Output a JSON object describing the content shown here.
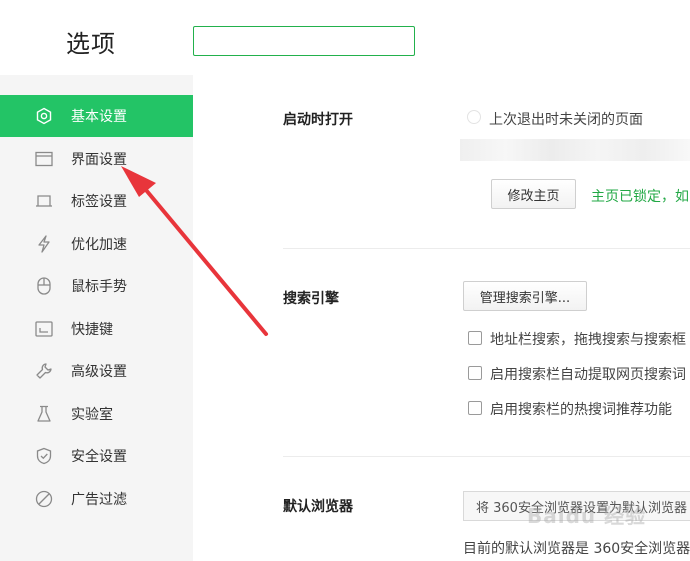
{
  "header": {
    "title": "选项",
    "search": {
      "value": "",
      "placeholder": ""
    }
  },
  "sidebar": {
    "items": [
      {
        "label": "基本设置",
        "icon": "gear-icon",
        "active": true
      },
      {
        "label": "界面设置",
        "icon": "window-icon",
        "active": false
      },
      {
        "label": "标签设置",
        "icon": "tab-icon",
        "active": false
      },
      {
        "label": "优化加速",
        "icon": "lightning-icon",
        "active": false
      },
      {
        "label": "鼠标手势",
        "icon": "mouse-icon",
        "active": false
      },
      {
        "label": "快捷键",
        "icon": "keyboard-icon",
        "active": false
      },
      {
        "label": "高级设置",
        "icon": "wrench-icon",
        "active": false
      },
      {
        "label": "实验室",
        "icon": "flask-icon",
        "active": false
      },
      {
        "label": "安全设置",
        "icon": "shield-icon",
        "active": false
      },
      {
        "label": "广告过滤",
        "icon": "block-icon",
        "active": false
      }
    ]
  },
  "startup": {
    "title": "启动时打开",
    "option_last_session": "上次退出时未关闭的页面",
    "modify_home_button": "修改主页",
    "home_locked_text": "主页已锁定，如"
  },
  "search_engine": {
    "title": "搜索引擎",
    "manage_button": "管理搜索引擎...",
    "options": [
      {
        "label": "地址栏搜索，拖拽搜索与搜索框",
        "checked": false
      },
      {
        "label": "启用搜索栏自动提取网页搜索词",
        "checked": false
      },
      {
        "label": "启用搜索栏的热搜词推荐功能",
        "checked": false
      }
    ]
  },
  "default_browser": {
    "title": "默认浏览器",
    "set_default_button": "将 360安全浏览器设置为默认浏览器",
    "current_text": "目前的默认浏览器是 360安全浏览器"
  },
  "watermark": "Baidu 经验",
  "colors": {
    "accent": "#23c466",
    "arrow": "#e8353b",
    "sidebar_bg": "#f5f5f5"
  }
}
